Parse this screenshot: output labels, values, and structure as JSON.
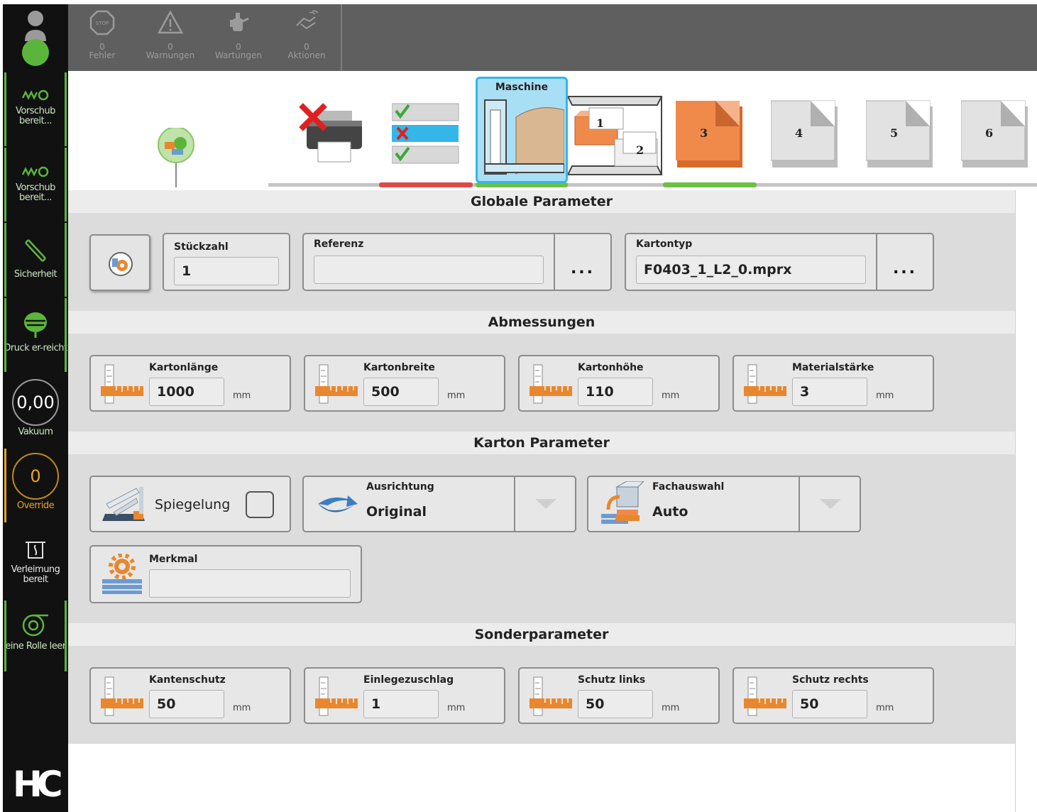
{
  "sidebar": {
    "items": [
      {
        "label": "Vorschub bereit..."
      },
      {
        "label": "Vorschub bereit..."
      },
      {
        "label": "Sicherheit"
      },
      {
        "label": "Druck er-reicht"
      },
      {
        "label": "Vakuum",
        "value": "0,00"
      },
      {
        "label": "Override",
        "value": "0"
      },
      {
        "label": "Verleimung bereit"
      },
      {
        "label": "eine Rolle leer"
      }
    ],
    "logo": "HC"
  },
  "topbar": {
    "alerts": [
      {
        "count": "0",
        "label": "Fehler",
        "icon": "stop-icon"
      },
      {
        "count": "0",
        "label": "Warnungen",
        "icon": "warning-icon"
      },
      {
        "count": "0",
        "label": "Wartungen",
        "icon": "oil-can-icon"
      },
      {
        "count": "0",
        "label": "Aktionen",
        "icon": "hand-icon"
      }
    ]
  },
  "tabs": {
    "active_label": "Maschine",
    "numbers": [
      "1",
      "2",
      "3",
      "4",
      "5",
      "6"
    ]
  },
  "sections": {
    "global": "Globale Parameter",
    "dimensions": "Abmessungen",
    "karton": "Karton Parameter",
    "special": "Sonderparameter"
  },
  "global": {
    "stueckzahl_label": "Stückzahl",
    "stueckzahl_value": "1",
    "referenz_label": "Referenz",
    "referenz_value": "",
    "kartontyp_label": "Kartontyp",
    "kartontyp_value": "F0403_1_L2_0.mprx",
    "more": "..."
  },
  "dimensions": [
    {
      "label": "Kartonlänge",
      "value": "1000",
      "unit": "mm"
    },
    {
      "label": "Kartonbreite",
      "value": "500",
      "unit": "mm"
    },
    {
      "label": "Kartonhöhe",
      "value": "110",
      "unit": "mm"
    },
    {
      "label": "Materialstärke",
      "value": "3",
      "unit": "mm"
    }
  ],
  "karton": {
    "spiegelung_label": "Spiegelung",
    "spiegelung_checked": false,
    "ausrichtung_label": "Ausrichtung",
    "ausrichtung_value": "Original",
    "fachauswahl_label": "Fachauswahl",
    "fachauswahl_value": "Auto",
    "merkmal_label": "Merkmal",
    "merkmal_value": ""
  },
  "special": [
    {
      "label": "Kantenschutz",
      "value": "50",
      "unit": "mm"
    },
    {
      "label": "Einlegezuschlag",
      "value": "1",
      "unit": "mm"
    },
    {
      "label": "Schutz links",
      "value": "50",
      "unit": "mm"
    },
    {
      "label": "Schutz rechts",
      "value": "50",
      "unit": "mm"
    }
  ],
  "colors": {
    "accent_green": "#5cb53b",
    "accent_orange": "#e9a41c",
    "tab_active": "#a9dff5",
    "status_red": "#e04848"
  }
}
